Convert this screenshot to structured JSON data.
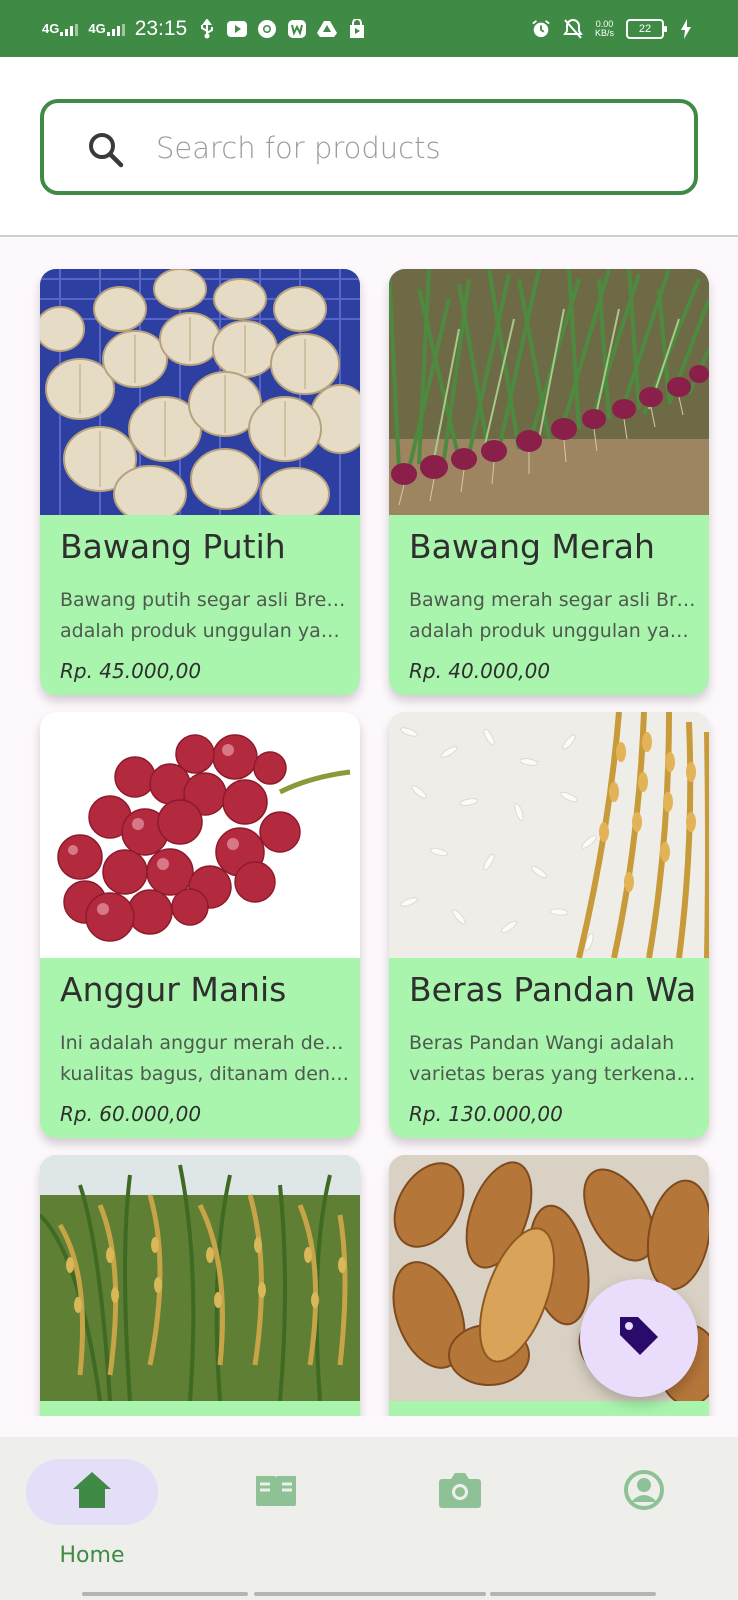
{
  "status_bar": {
    "network_1": "4G",
    "network_2": "4G",
    "time": "23:15",
    "speed_value": "0.00",
    "speed_unit": "KB/s",
    "battery": "22"
  },
  "search": {
    "placeholder": "Search for products"
  },
  "products": [
    {
      "name": "Bawang Putih",
      "desc_line1": "Bawang putih segar asli Brebes",
      "desc_line2": "adalah produk unggulan yang b...",
      "price": "Rp. 45.000,00"
    },
    {
      "name": "Bawang Merah",
      "desc_line1": "Bawang merah segar asli Brebes",
      "desc_line2": "adalah produk unggulan yang b...",
      "price": "Rp. 40.000,00"
    },
    {
      "name": "Anggur Manis",
      "desc_line1": "Ini adalah anggur merah dengan",
      "desc_line2": "kualitas bagus, ditanam dengan...",
      "price": "Rp. 60.000,00"
    },
    {
      "name": "Beras Pandan Wangi",
      "desc_line1": "Beras Pandan Wangi adalah",
      "desc_line2": "varietas beras yang terkenal d...",
      "price": "Rp. 130.000,00"
    }
  ],
  "bottom_nav": {
    "items": [
      {
        "label": "Home",
        "icon": "home-icon"
      },
      {
        "label": "",
        "icon": "book-icon"
      },
      {
        "label": "",
        "icon": "camera-icon"
      },
      {
        "label": "",
        "icon": "profile-icon"
      }
    ]
  },
  "colors": {
    "primary": "#3f8a45",
    "card_bg": "#a9f5ae",
    "fab_bg": "#e9ddfb",
    "fab_icon": "#2a0a6b"
  }
}
